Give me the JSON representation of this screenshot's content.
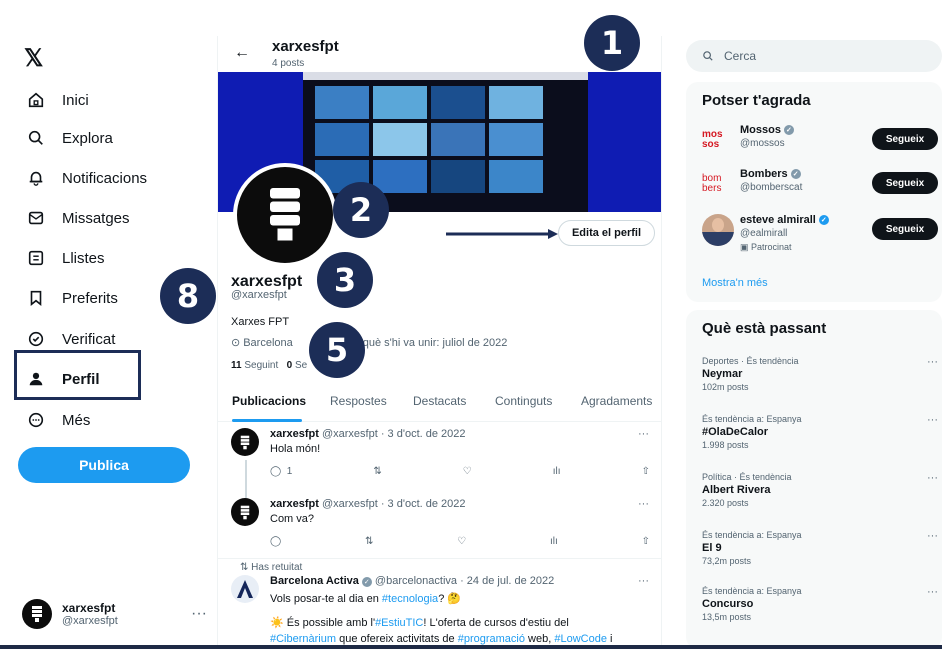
{
  "sidebar": {
    "logo": "𝕏",
    "items": [
      {
        "label": "Inici"
      },
      {
        "label": "Explora"
      },
      {
        "label": "Notificacions"
      },
      {
        "label": "Missatges"
      },
      {
        "label": "Llistes"
      },
      {
        "label": "Preferits"
      },
      {
        "label": "Verificat"
      },
      {
        "label": "Perfil"
      },
      {
        "label": "Més"
      }
    ],
    "post_button": "Publica",
    "account": {
      "name": "xarxesfpt",
      "handle": "@xarxesfpt",
      "more": "···"
    }
  },
  "topbar": {
    "back": "←",
    "title": "xarxesfpt",
    "subtitle": "4 posts"
  },
  "profile": {
    "edit_button": "Edita el perfil",
    "name": "xarxesfpt",
    "handle": "@xarxesfpt",
    "bio": "Xarxes FPT",
    "location": "Barcelona",
    "joined": "què s'hi va unir: juliol de 2022",
    "following_count": "11",
    "following_label": "Seguint",
    "followers_count": "0",
    "followers_label": "Se"
  },
  "tabs": [
    {
      "label": "Publicacions",
      "active": true
    },
    {
      "label": "Respostes"
    },
    {
      "label": "Destacats"
    },
    {
      "label": "Continguts"
    },
    {
      "label": "Agradaments"
    }
  ],
  "tweets": [
    {
      "name": "xarxesfpt",
      "meta": "@xarxesfpt · 3 d'oct. de 2022",
      "text": "Hola món!",
      "replies": "1",
      "more": "···"
    },
    {
      "name": "xarxesfpt",
      "meta": "@xarxesfpt · 3 d'oct. de 2022",
      "text": "Com va?",
      "more": "···"
    }
  ],
  "retweet": {
    "label": "Has retuitat",
    "name": "Barcelona Activa",
    "meta": "@barcelonactiva · 24 de jul. de 2022",
    "line1_a": "Vols posar-te al dia en ",
    "line1_tag": "#tecnologia",
    "line1_b": "? 🤔",
    "line2_a": "☀️ És possible amb l'",
    "line2_tag": "#EstiuTIC",
    "line2_b": "! L'oferta de cursos d'estiu del",
    "line3_tag1": "#Cibernàrium",
    "line3_a": " que ofereix activitats de ",
    "line3_tag2": "#programació",
    "line3_b": " web, ",
    "line3_tag3": "#LowCode",
    "line3_c": " i",
    "more": "···"
  },
  "right": {
    "search_placeholder": "Cerca",
    "who_title": "Potser t'agrada",
    "who": [
      {
        "logo_top": "mos",
        "logo_bottom": "sos",
        "name": "Mossos",
        "handle": "@mossos",
        "button": "Segueix"
      },
      {
        "logo_top": "bom",
        "logo_bottom": "bers",
        "name": "Bombers",
        "handle": "@bomberscat",
        "button": "Segueix"
      },
      {
        "name": "esteve almirall",
        "handle": "@ealmirall",
        "promo": "Patrocinat",
        "button": "Segueix"
      }
    ],
    "show_more": "Mostra'n més",
    "trends_title": "Què està passant",
    "trends": [
      {
        "context": "Deportes · És tendència",
        "title": "Neymar",
        "count": "102m posts"
      },
      {
        "context": "És tendència a: Espanya",
        "title": "#OlaDeCalor",
        "count": "1.998 posts"
      },
      {
        "context": "Política · És tendència",
        "title": "Albert Rivera",
        "count": "2.320 posts"
      },
      {
        "context": "És tendència a: Espanya",
        "title": "El 9",
        "count": "73,2m posts"
      },
      {
        "context": "És tendència a: Espanya",
        "title": "Concurso",
        "count": "13,5m posts"
      }
    ],
    "trend_more": "···"
  },
  "markers": [
    "1",
    "2",
    "3",
    "5",
    "8"
  ],
  "colors": {
    "accent": "#1d9bf0",
    "marker": "#1c2d57",
    "banner": "#0f1cb3"
  }
}
